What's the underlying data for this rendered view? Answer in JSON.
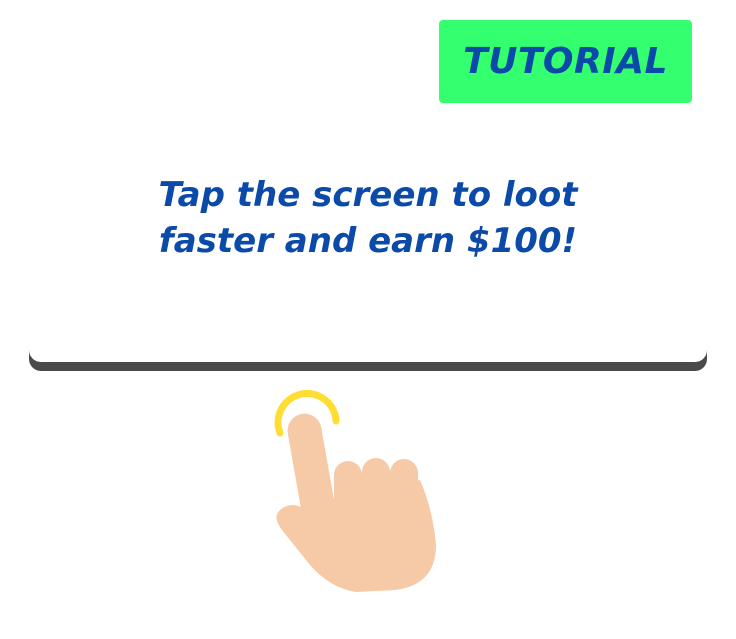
{
  "badge": {
    "label": "TUTORIAL"
  },
  "message": {
    "line1": "Tap the screen to loot",
    "line2": "faster and earn $100!"
  },
  "hint": {
    "icon": "tap-hand-icon"
  },
  "colors": {
    "badge_bg": "#34ff6e",
    "text": "#0b4aa8",
    "card_shadow": "#4a4a4a",
    "skin": "#f6caa6",
    "tap_ring": "#ffdd33"
  }
}
